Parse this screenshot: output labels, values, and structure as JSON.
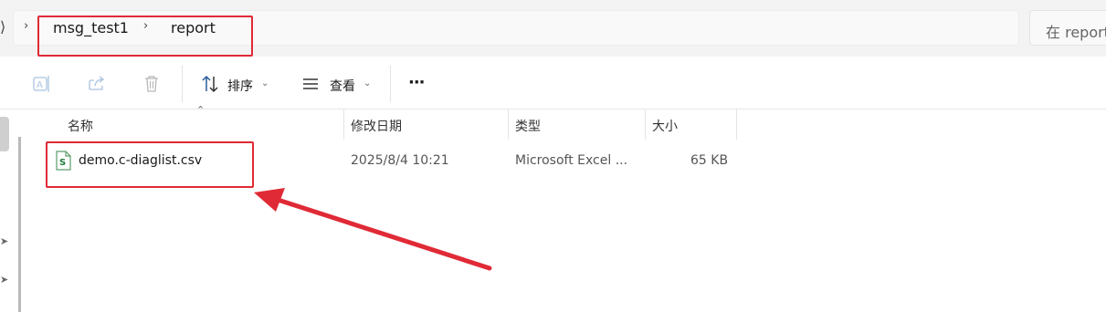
{
  "address_bar": {
    "breadcrumb": [
      "msg_test1",
      "report"
    ],
    "separator": "›",
    "search_placeholder": "在 report 中搜索"
  },
  "toolbar": {
    "items": [
      {
        "icon": "rename-icon",
        "enabled": false
      },
      {
        "icon": "share-icon",
        "enabled": false
      },
      {
        "icon": "delete-icon",
        "enabled": false
      }
    ],
    "sort_label": "排序",
    "view_label": "查看",
    "more_label": "···"
  },
  "columns": [
    "名称",
    "修改日期",
    "类型",
    "大小"
  ],
  "files": [
    {
      "name": "demo.c-diaglist.csv",
      "modified": "2025/8/4 10:21",
      "type": "Microsoft Excel ...",
      "size": "65 KB",
      "icon": "excel-csv-icon"
    }
  ],
  "annotations": {
    "highlight_color": "#e02a36",
    "highlighted": [
      "breadcrumb",
      "file-row"
    ]
  }
}
